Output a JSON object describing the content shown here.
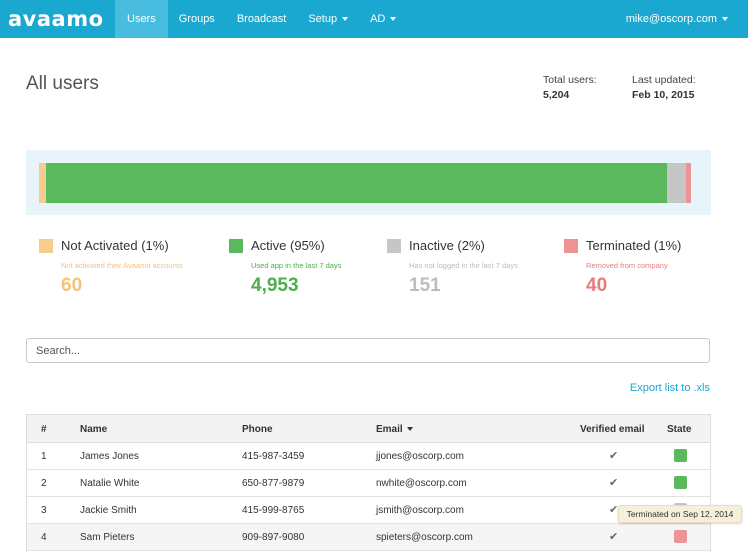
{
  "brand": {
    "logo_text": "avaamo",
    "nav_color": "#1aa7d0"
  },
  "nav": {
    "items": [
      {
        "label": "Users",
        "active": true,
        "dropdown": false
      },
      {
        "label": "Groups",
        "active": false,
        "dropdown": false
      },
      {
        "label": "Broadcast",
        "active": false,
        "dropdown": false
      },
      {
        "label": "Setup",
        "active": false,
        "dropdown": true
      },
      {
        "label": "AD",
        "active": false,
        "dropdown": true
      }
    ],
    "user": "mike@oscorp.com"
  },
  "page": {
    "title": "All users",
    "total_label": "Total users:",
    "total_value": "5,204",
    "updated_label": "Last updated:",
    "updated_value": "Feb 10, 2015"
  },
  "distribution": {
    "segments": [
      {
        "key": "not_activated",
        "fraction": 0.0115,
        "color": "#f7cd8e"
      },
      {
        "key": "active",
        "fraction": 0.9517,
        "color": "#5cb85c"
      },
      {
        "key": "inactive",
        "fraction": 0.029,
        "color": "#c6c6c6"
      },
      {
        "key": "terminated",
        "fraction": 0.0077,
        "color": "#ee9393"
      }
    ]
  },
  "legend": [
    {
      "title": "Not Activated (1%)",
      "subtitle": "Not activated their Avaamo accounts",
      "count": "60",
      "color": "#f7cd8e",
      "text_color": "#f5c27a"
    },
    {
      "title": "Active (95%)",
      "subtitle": "Used app in the last 7 days",
      "count": "4,953",
      "color": "#5cb85c",
      "text_color": "#4cae4c"
    },
    {
      "title": "Inactive (2%)",
      "subtitle": "Has not logged in the last 7 days",
      "count": "151",
      "color": "#c6c6c6",
      "text_color": "#bcbcbc"
    },
    {
      "title": "Terminated (1%)",
      "subtitle": "Removed from company",
      "count": "40",
      "color": "#ee9393",
      "text_color": "#e57b7b"
    }
  ],
  "search": {
    "placeholder": "Search..."
  },
  "export_label": "Export list to .xls",
  "table": {
    "headers": {
      "num": "#",
      "name": "Name",
      "phone": "Phone",
      "email": "Email",
      "verified": "Verified email",
      "state": "State"
    },
    "rows": [
      {
        "num": "1",
        "name": "James Jones",
        "phone": "415-987-3459",
        "email": "jjones@oscorp.com",
        "verified": "✔",
        "state_color": "#5cb85c"
      },
      {
        "num": "2",
        "name": "Natalie White",
        "phone": "650-877-9879",
        "email": "nwhite@oscorp.com",
        "verified": "✔",
        "state_color": "#5cb85c"
      },
      {
        "num": "3",
        "name": "Jackie Smith",
        "phone": "415-999-8765",
        "email": "jsmith@oscorp.com",
        "verified": "✔",
        "state_color": "#c6c6c6"
      },
      {
        "num": "4",
        "name": "Sam Pieters",
        "phone": "909-897-9080",
        "email": "spieters@oscorp.com",
        "verified": "✔",
        "state_color": "#ee9393"
      }
    ]
  },
  "tooltip": "Terminated on Sep 12, 2014"
}
